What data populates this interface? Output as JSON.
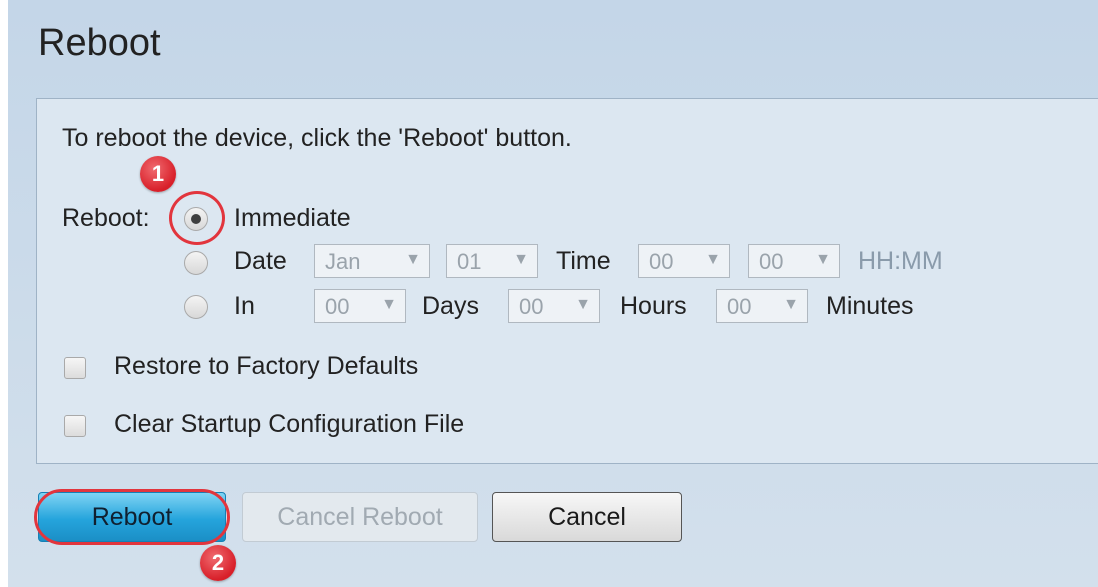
{
  "page": {
    "title": "Reboot"
  },
  "form": {
    "instruction": "To reboot the device, click the 'Reboot' button.",
    "reboot_label": "Reboot:",
    "options": {
      "immediate": {
        "label": "Immediate",
        "selected": true
      },
      "date": {
        "label": "Date",
        "selected": false
      },
      "in": {
        "label": "In",
        "selected": false
      }
    },
    "date_row": {
      "month": "Jan",
      "day": "01",
      "time_label": "Time",
      "hour": "00",
      "minute": "00",
      "format_hint": "HH:MM"
    },
    "in_row": {
      "days": "00",
      "days_label": "Days",
      "hours": "00",
      "hours_label": "Hours",
      "minutes": "00",
      "minutes_label": "Minutes"
    },
    "restore_defaults": {
      "label": "Restore to Factory Defaults",
      "checked": false
    },
    "clear_startup": {
      "label": "Clear Startup Configuration File",
      "checked": false
    }
  },
  "buttons": {
    "reboot": "Reboot",
    "cancel_reboot": "Cancel Reboot",
    "cancel": "Cancel"
  },
  "annotations": {
    "step1": "1",
    "step2": "2",
    "color": "#e2353d"
  },
  "icons": {
    "dropdown_arrow": "▼"
  }
}
